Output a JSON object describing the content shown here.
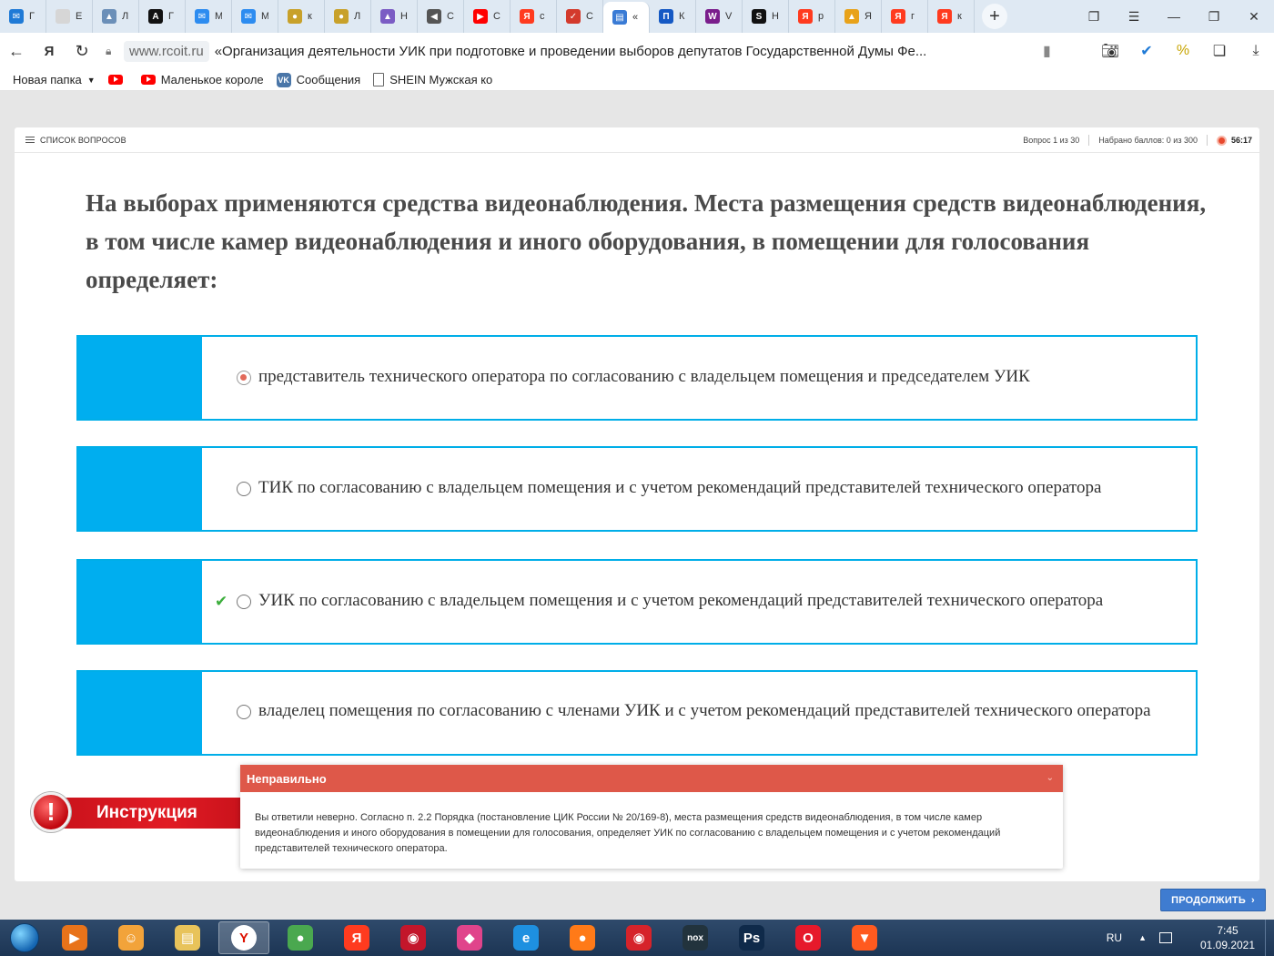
{
  "browser": {
    "tabs": [
      {
        "icon": "mail-icon",
        "color": "#1f7ad6",
        "glyph": "✉",
        "label": "Г"
      },
      {
        "icon": "flag-icon",
        "color": "#d6d6d6",
        "glyph": "",
        "label": "Е"
      },
      {
        "icon": "triangle-icon",
        "color": "#6b8fb8",
        "glyph": "▲",
        "label": "Л"
      },
      {
        "icon": "letter-a-icon",
        "color": "#111111",
        "glyph": "A",
        "label": "Г"
      },
      {
        "icon": "chat-icon",
        "color": "#2d8cf0",
        "glyph": "✉",
        "label": "М"
      },
      {
        "icon": "chat-icon",
        "color": "#2d8cf0",
        "glyph": "✉",
        "label": "М"
      },
      {
        "icon": "color-wheel-icon",
        "color": "#c8a12a",
        "glyph": "●",
        "label": "к"
      },
      {
        "icon": "color-wheel-icon",
        "color": "#c8a12a",
        "glyph": "●",
        "label": "Л"
      },
      {
        "icon": "image-icon",
        "color": "#7b5cc4",
        "glyph": "▲",
        "label": "Н"
      },
      {
        "icon": "sound-icon",
        "color": "#555555",
        "glyph": "◀",
        "label": "С"
      },
      {
        "icon": "youtube-icon",
        "color": "#ff0000",
        "glyph": "▶",
        "label": "С"
      },
      {
        "icon": "yandex-icon",
        "color": "#ff3b1f",
        "glyph": "Я",
        "label": "с"
      },
      {
        "icon": "checkbox-icon",
        "color": "#d33a2c",
        "glyph": "✓",
        "label": "С"
      },
      {
        "icon": "document-icon",
        "color": "#3a7bd5",
        "glyph": "▤",
        "label": "«"
      },
      {
        "icon": "p-icon",
        "color": "#1559c4",
        "glyph": "П",
        "label": "К"
      },
      {
        "icon": "w-icon",
        "color": "#7a1e8c",
        "glyph": "W",
        "label": "V"
      },
      {
        "icon": "s-icon",
        "color": "#111111",
        "glyph": "S",
        "label": "Н"
      },
      {
        "icon": "yandex-icon",
        "color": "#ff3b1f",
        "glyph": "Я",
        "label": "р"
      },
      {
        "icon": "picture-icon",
        "color": "#e8a21a",
        "glyph": "▲",
        "label": "Я"
      },
      {
        "icon": "yandex-icon",
        "color": "#ff3b1f",
        "glyph": "Я",
        "label": "г"
      },
      {
        "icon": "yandex-icon",
        "color": "#ff3b1f",
        "glyph": "Я",
        "label": "к"
      }
    ],
    "domain": "www.rcoit.ru",
    "page_title": "«Организация деятельности УИК при подготовке и проведении выборов депутатов Государственной Думы Фе...",
    "bookmarks": [
      {
        "label": "Новая папка",
        "icon": "folder-icon"
      },
      {
        "label": "",
        "icon": "youtube-icon"
      },
      {
        "label": "Маленькое короле",
        "icon": "youtube-icon"
      },
      {
        "label": "Сообщения",
        "icon": "vk-icon"
      },
      {
        "label": "SHEIN Мужская ко",
        "icon": "document-icon"
      }
    ]
  },
  "quiz": {
    "questions_list_label": "СПИСОК ВОПРОСОВ",
    "question_counter": "Вопрос 1 из 30",
    "score": "Набрано баллов: 0 из 300",
    "timer": "56:17",
    "question": "На выборах применяются средства видеонаблюдения. Места размещения средств видеонаблюдения, в том числе камер видеонаблюдения и иного оборудования, в помещении для голосования определяет:",
    "answers": [
      {
        "text": "представитель технического оператора по согласованию с владельцем помещения и председателем УИК",
        "selected": true,
        "correct": false
      },
      {
        "text": "ТИК по согласованию с владельцем помещения и с учетом рекомендаций представителей технического оператора",
        "selected": false,
        "correct": false
      },
      {
        "text": "УИК по согласованию с владельцем помещения и с учетом рекомендаций представителей технического оператора",
        "selected": false,
        "correct": true
      },
      {
        "text": "владелец помещения по согласованию с членами УИК и с учетом рекомендаций представителей технического оператора",
        "selected": false,
        "correct": false
      }
    ],
    "instruction_label": "Инструкция",
    "feedback_title": "Неправильно",
    "feedback_text": "Вы ответили неверно. Согласно п. 2.2 Порядка (постановление ЦИК России № 20/169-8), места размещения средств видеонаблюдения, в том числе камер видеонаблюдения и иного оборудования в помещении для голосования, определяет УИК по согласованию с владельцем помещения и с учетом рекомендаций представителей технического оператора.",
    "continue_label": "ПРОДОЛЖИТЬ",
    "colors": {
      "accent": "#00aeef",
      "error": "#de5849",
      "button": "#3f7cd0",
      "correct": "#3cae3c"
    }
  },
  "taskbar": {
    "apps": [
      {
        "icon": "media-player-icon",
        "color": "#e8731a",
        "glyph": "▶"
      },
      {
        "icon": "photo-viewer-icon",
        "color": "#f2a33a",
        "glyph": "☺"
      },
      {
        "icon": "file-explorer-icon",
        "color": "#e8c35a",
        "glyph": "▤"
      },
      {
        "icon": "yandex-browser-icon",
        "color": "#ffffff",
        "glyph": "Y",
        "active": true
      },
      {
        "icon": "chrome-icon",
        "color": "#4aa84f",
        "glyph": "●"
      },
      {
        "icon": "yandex-icon",
        "color": "#ff3b1f",
        "glyph": "Я"
      },
      {
        "icon": "app-icon",
        "color": "#c3162b",
        "glyph": "◉"
      },
      {
        "icon": "polygon-icon",
        "color": "#e0448b",
        "glyph": "◆"
      },
      {
        "icon": "ie-icon",
        "color": "#1e90e0",
        "glyph": "e"
      },
      {
        "icon": "firefox-icon",
        "color": "#ff7a18",
        "glyph": "●"
      },
      {
        "icon": "app-icon",
        "color": "#d6232a",
        "glyph": "◉"
      },
      {
        "icon": "nox-icon",
        "color": "#22333d",
        "glyph": "nox"
      },
      {
        "icon": "photoshop-icon",
        "color": "#0f2a4a",
        "glyph": "Ps"
      },
      {
        "icon": "opera-icon",
        "color": "#e6192b",
        "glyph": "O"
      },
      {
        "icon": "brave-icon",
        "color": "#ff5a1f",
        "glyph": "▼"
      }
    ],
    "lang": "RU",
    "time": "7:45",
    "date": "01.09.2021"
  }
}
